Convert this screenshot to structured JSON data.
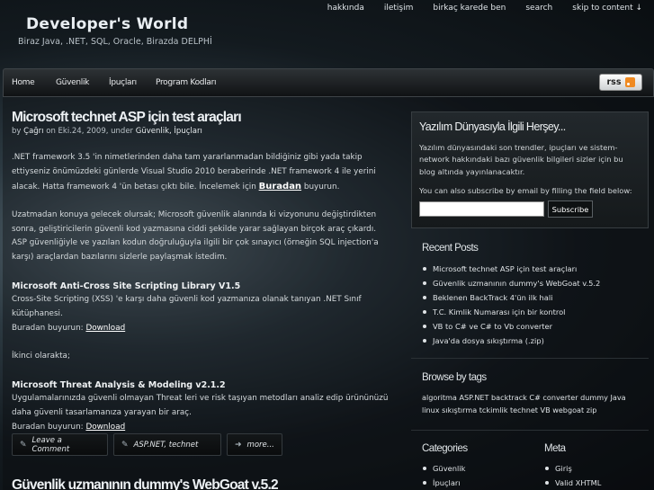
{
  "site": {
    "title": "Developer's World",
    "tagline": "Biraz Java, .NET, SQL, Oracle, Birazda DELPHİ"
  },
  "top_nav": [
    "hakkında",
    "iletişim",
    "birkaç karede ben",
    "search",
    "skip to content ↓"
  ],
  "main_nav": [
    "Home",
    "Güvenlik",
    "İpuçları",
    "Program Kodları"
  ],
  "rss_label": "rss",
  "post": {
    "title": "Microsoft technet ASP için test araçları",
    "meta_by": "by ",
    "meta_author": "Çağrı",
    "meta_on": " on Eki.24, 2009, under ",
    "meta_cats": "Güvenlik, İpuçları",
    "p1": ".NET framework 3.5 'in nimetlerinden daha tam yararlanmadan bildiğiniz gibi yada takip ettiyseniz önümüzdeki günlerde Visual Studio 2010 beraberinde .NET framework 4 ile yerini alacak. Hatta framework 4 'ün betası çıktı bile. İncelemek için ",
    "p1_link": "Buradan",
    "p1_end": " buyurun.",
    "p2": "Uzatmadan konuya gelecek olursak; Microsoft güvenlik alanında ki vizyonunu değiştirdikten sonra, geliştiricilerin güvenli kod yazmasına ciddi şekilde yarar sağlayan birçok araç çıkardı. ASP güvenliğiyle ve yazılan kodun doğruluğuyla ilgili bir çok sınayıcı (örneğin SQL injection'a karşı) araçlardan bazılarını sizlerle paylaşmak istedim.",
    "h1": "Microsoft Anti-Cross Site Scripting Library V1.5",
    "p3": "Cross-Site Scripting (XSS) 'e karşı daha güvenli kod yazmanıza olanak tanıyan .NET Sınıf kütüphanesi.",
    "buy1": "Buradan buyurun: ",
    "download1": "Download",
    "p4": "İkinci olarakta;",
    "h2": "Microsoft Threat Analysis & Modeling v2.1.2",
    "p5": "Uygulamalarınızda güvenli olmayan Threat leri ve risk taşıyan metodları analiz edip ürününüzü daha güvenli tasarlamanıza yarayan bir araç.",
    "buy2": "Buradan buyurun: ",
    "download2": "Download"
  },
  "post_actions": {
    "comment": "Leave a Comment",
    "tags": "ASP.NET, technet",
    "more": "more..."
  },
  "next_post_title": "Güvenlik uzmanının dummy's WebGoat v.5.2",
  "about_box": {
    "title": "Yazılım Dünyasıyla İlgili Herşey...",
    "desc": "Yazılım dünyasındaki son trendler, ipuçları ve sistem-network hakkındaki bazı güvenlik bilgileri sizler için bu blog altında yayınlanacaktır.",
    "subscribe_text": "You can also subscribe by email by filling the field below:",
    "email_placeholder": "",
    "subscribe_button": "Subscribe"
  },
  "recent_posts": {
    "title": "Recent Posts",
    "items": [
      "Microsoft technet ASP için test araçları",
      "Güvenlik uzmanının dummy's WebGoat v.5.2",
      "Beklenen BackTrack 4'ün ilk hali",
      "T.C. Kimlik Numarası için bir kontrol",
      "VB to C# ve C# to Vb converter",
      "Java'da dosya sıkıştırma (.zip)"
    ]
  },
  "tags": {
    "title": "Browse by tags",
    "text": "algoritma ASP.NET backtrack C# converter dummy Java linux sıkıştırma tckimlik technet VB webgoat zip"
  },
  "categories": {
    "title": "Categories",
    "items": [
      "Güvenlik",
      "İpuçları"
    ]
  },
  "meta": {
    "title": "Meta",
    "items": [
      "Giriş",
      "Valid XHTML"
    ]
  }
}
